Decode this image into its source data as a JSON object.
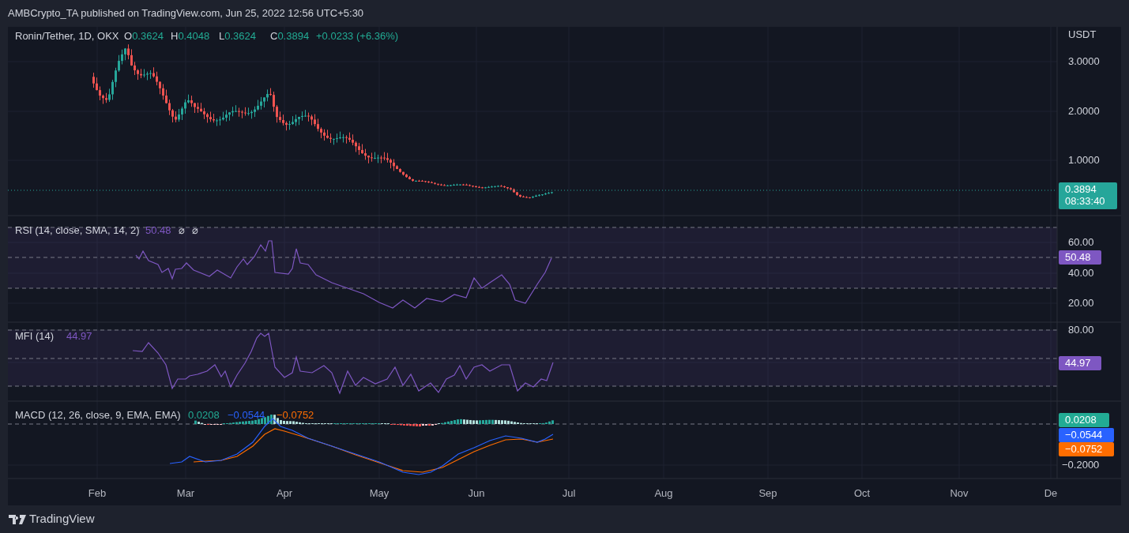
{
  "header": "AMBCrypto_TA published on TradingView.com, Jun 25, 2022 12:56 UTC+5:30",
  "price_pane": {
    "legend": {
      "symbol": "Ronin/Tether, 1D, OKX",
      "ohlc": [
        {
          "label": "O",
          "value": "0.3624"
        },
        {
          "label": "H",
          "value": "0.4048"
        },
        {
          "label": "L",
          "value": "0.3624"
        },
        {
          "label": "C",
          "value": "0.3894"
        }
      ],
      "change": "+0.0233 (+6.36%)"
    },
    "currency": "USDT",
    "axis_labels": [
      "3.0000",
      "2.0000",
      "1.0000"
    ],
    "last_price": "0.3894",
    "countdown": "08:33:40"
  },
  "rsi_pane": {
    "title": "RSI (14, close, SMA, 14, 2)",
    "value": "50.48",
    "flags": [
      "⌀",
      "⌀"
    ],
    "axis_labels": [
      "60.00",
      "40.00",
      "20.00"
    ],
    "marker": "50.48"
  },
  "mfi_pane": {
    "title": "MFI (14)",
    "value": "44.97",
    "axis_labels": [
      "80.00"
    ],
    "marker": "44.97"
  },
  "macd_pane": {
    "title": "MACD (12, 26, close, 9, EMA, EMA)",
    "values": [
      {
        "text": "0.0208",
        "color": "#22ab94"
      },
      {
        "text": "−0.0544",
        "color": "#2962ff"
      },
      {
        "text": "−0.0752",
        "color": "#ff6d00"
      }
    ],
    "axis_labels": [
      "−0.2000"
    ],
    "markers": [
      {
        "text": "0.0208",
        "color": "#22ab94"
      },
      {
        "text": "−0.0544",
        "color": "#2962ff"
      },
      {
        "text": "−0.0752",
        "color": "#ff6d00"
      }
    ]
  },
  "time_axis": [
    "Feb",
    "Mar",
    "Apr",
    "May",
    "Jun",
    "Jul",
    "Aug",
    "Sep",
    "Oct",
    "Nov",
    "De"
  ],
  "footer": "TradingView"
}
